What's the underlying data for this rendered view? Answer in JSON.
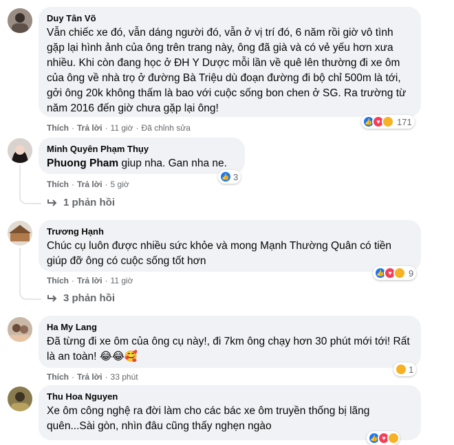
{
  "comments": [
    {
      "name": "Duy Tân Võ",
      "text": "Vẫn chiếc xe đó, vẫn dáng người đó, vẫn ở vị trí đó, 6 năm rồi giờ vô tình gặp lại hình ảnh của ông trên trang này, ông đã già và có vẻ yếu hơn xưa nhiều. Khi còn đang học ở ĐH Y Dược mỗi lần về quê lên thường đi xe ôm của ông về nhà trọ ở đường Bà Triệu dù đoạn đường đi bộ chỉ 500m là tới, gởi ông 20k không thấm là bao với cuộc sống bon chen ở SG. Ra trường từ năm 2016 đến giờ chưa gặp lại ông!",
      "like": "Thích",
      "reply": "Trả lời",
      "time": "11 giờ",
      "edited": "Đã chỉnh sửa",
      "reaction_count": "171"
    },
    {
      "name": "Minh Quyên Phạm Thụy",
      "mention": "Phuong Pham",
      "text": " giup nha. Gan nha ne.",
      "like": "Thích",
      "reply": "Trả lời",
      "time": "5 giờ",
      "reaction_count": "3",
      "replies": "1 phản hồi"
    },
    {
      "name": "Trương Hạnh",
      "text": "Chúc cụ luôn được nhiều sức khỏe và mong Mạnh Thường Quân có tiền giúp đỡ ông có cuộc sống tốt hơn",
      "like": "Thích",
      "reply": "Trả lời",
      "time": "11 giờ",
      "reaction_count": "9",
      "replies": "3 phản hồi"
    },
    {
      "name": "Ha My Lang",
      "text": "Đã từng đi xe ôm của ông cụ này!, đi 7km ông chạy hơn 30 phút mới tới! Rất là an toàn! 😂😂🥰",
      "like": "Thích",
      "reply": "Trả lời",
      "time": "33 phút",
      "reaction_count": "1"
    },
    {
      "name": "Thu Hoa Nguyen",
      "text": "Xe ôm công nghệ ra đời làm cho các bác xe ôm truyền thống bị lãng quên...Sài gòn, nhìn đâu cũng thấy nghẹn ngào"
    }
  ],
  "colors": {
    "bubble": "#f0f2f5",
    "secondary_text": "#65676b",
    "like_blue": "#1877f2",
    "love_red": "#f33e58",
    "haha_yellow": "#f7b125"
  },
  "icons": [
    "like-reaction-icon",
    "love-reaction-icon",
    "haha-reaction-icon",
    "reply-arrow-icon"
  ]
}
